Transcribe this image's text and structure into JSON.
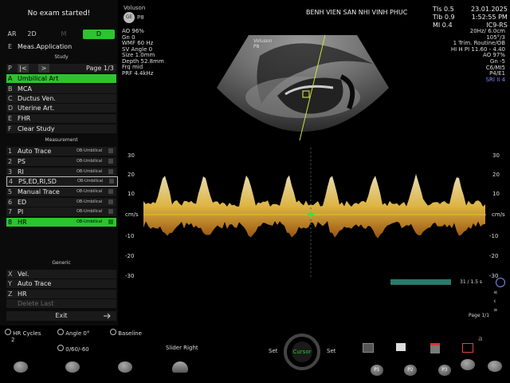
{
  "left_panel": {
    "no_exam": "No exam started!",
    "modes": [
      "AR",
      "2D",
      "M",
      "D"
    ],
    "meas_app": {
      "key": "E",
      "label": "Meas.Application"
    },
    "study_header": "Study",
    "pager": {
      "key": "P",
      "prev": "|<",
      "next": ">",
      "page": "Page 1/3"
    },
    "study_items": [
      {
        "key": "A",
        "label": "Umbilical Art"
      },
      {
        "key": "B",
        "label": "MCA"
      },
      {
        "key": "C",
        "label": "Ductus Ven."
      },
      {
        "key": "D",
        "label": "Uterine Art."
      },
      {
        "key": "E",
        "label": "FHR"
      },
      {
        "key": "F",
        "label": "Clear Study"
      }
    ],
    "measurement_header": "Measurement",
    "measurements": [
      {
        "key": "1",
        "label": "Auto Trace",
        "tag": "OB-Umbilical"
      },
      {
        "key": "2",
        "label": "PS",
        "tag": "OB-Umbilical"
      },
      {
        "key": "3",
        "label": "RI",
        "tag": "OB-Umbilical"
      },
      {
        "key": "4",
        "label": "PS,ED,RI,SD",
        "tag": "OB-Umbilical"
      },
      {
        "key": "5",
        "label": "Manual Trace",
        "tag": "OB-Umbilical"
      },
      {
        "key": "6",
        "label": "ED",
        "tag": "OB-Umbilical"
      },
      {
        "key": "7",
        "label": "PI",
        "tag": "OB-Umbilical"
      },
      {
        "key": "8",
        "label": "HR",
        "tag": "OB-Umbilical"
      }
    ],
    "generic_header": "Generic",
    "generic_items": [
      {
        "key": "X",
        "label": "Vel."
      },
      {
        "key": "Y",
        "label": "Auto Trace"
      },
      {
        "key": "Z",
        "label": "HR"
      },
      {
        "key": "",
        "label": "Delete Last"
      }
    ],
    "exit": "Exit"
  },
  "header": {
    "brand": "Voluson",
    "probe": "P8",
    "title": "BENH VIEN SAN NHI VINH PHUC",
    "tis": "TIs  0.5",
    "tib": "TIb  0.9",
    "mi": "MI  0.4",
    "date": "23.01.2025",
    "time": "1:52:55 PM",
    "probe_model": "IC9-RS"
  },
  "params_left": [
    "AO 96%",
    "Gn  0",
    "WMF 60 Hz",
    "SV Angle 0",
    "Size  1.0mm",
    "Depth 52.8mm",
    "Frq mid",
    "PRF 4.4kHz"
  ],
  "params_right": [
    "20Hz/ 6.0cm",
    "105°/3",
    "1 Trim. Routine/OB",
    "HI H PI 11.60 - 4.40",
    "AO 97%",
    "Gn -5",
    "C6/MI5",
    "P4/E1",
    "SRI II 4"
  ],
  "image_labels": {
    "brand": "Voluson",
    "probe": "P8"
  },
  "doppler": {
    "unit": "cm/s",
    "ticks_left": [
      "30",
      "20",
      "10",
      "-10",
      "-20",
      "-30"
    ],
    "ticks_right": [
      "30",
      "20",
      "10",
      "-10",
      "-20",
      "-30"
    ],
    "sweep": "31 / 1.5 s",
    "page": "Page 1/1"
  },
  "bottom": {
    "hr_cycles": "HR Cycles",
    "hr_cycles_value": "2",
    "angle": "Angle 0°",
    "baseline": "Baseline",
    "angle_sub": "0/60/-60",
    "slider": "Slider Right",
    "set_left": "Set",
    "cursor": "Cursor",
    "set_right": "Set",
    "p_buttons": [
      "P1",
      "P2",
      "P3"
    ]
  },
  "colors": {
    "accent": "#2dc42d",
    "spectrum": "#f6c84a",
    "header_blue": "#7a8cff"
  }
}
